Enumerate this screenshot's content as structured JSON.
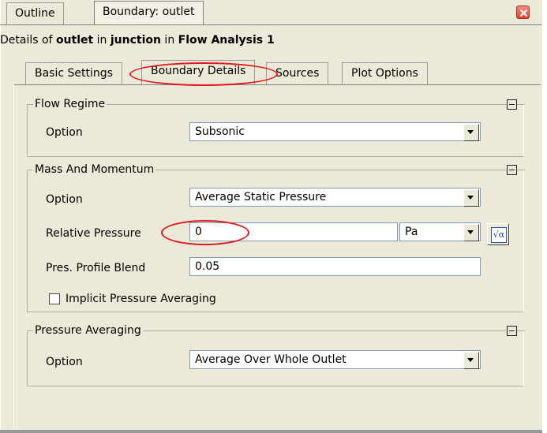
{
  "top_tabs": [
    {
      "label": "Outline"
    },
    {
      "label": "Boundary: outlet"
    }
  ],
  "details": {
    "prefix": "Details of ",
    "boundary": "outlet",
    "mid1": " in ",
    "domain": "junction",
    "mid2": " in ",
    "analysis": "Flow Analysis 1"
  },
  "inner_tabs": [
    {
      "label": "Basic Settings"
    },
    {
      "label": "Boundary Details"
    },
    {
      "label": "Sources"
    },
    {
      "label": "Plot Options"
    }
  ],
  "flow_regime": {
    "title": "Flow Regime",
    "option_label": "Option",
    "option_value": "Subsonic"
  },
  "mass_momentum": {
    "title": "Mass And Momentum",
    "option_label": "Option",
    "option_value": "Average Static Pressure",
    "rel_pressure_label": "Relative Pressure",
    "rel_pressure_value": "0",
    "rel_pressure_unit": "Pa",
    "profile_blend_label": "Pres. Profile Blend",
    "profile_blend_value": "0.05",
    "implicit_label": "Implicit Pressure Averaging"
  },
  "pressure_averaging": {
    "title": "Pressure Averaging",
    "option_label": "Option",
    "option_value": "Average Over Whole Outlet"
  },
  "icons": {
    "close": "close-icon",
    "collapse": "collapse-icon",
    "expression": "expression-icon"
  },
  "colors": {
    "panel_bg": "#ece9d8",
    "highlight_ellipse": "#e0191d",
    "field_border": "#7f9db9"
  }
}
